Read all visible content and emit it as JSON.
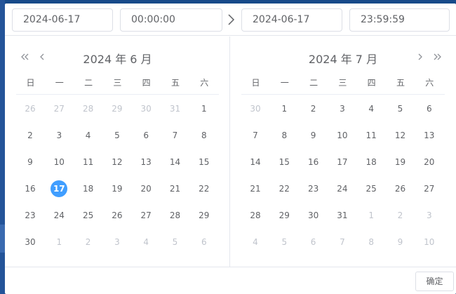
{
  "header": {
    "start_date": "2024-06-17",
    "start_time": "00:00:00",
    "end_date": "2024-06-17",
    "end_time": "23:59:59",
    "separator_icon": "chevron-right-icon"
  },
  "weekdays": [
    "日",
    "一",
    "二",
    "三",
    "四",
    "五",
    "六"
  ],
  "left_panel": {
    "title": "2024 年 6 月",
    "nav": [
      "double-chevron-left-icon",
      "chevron-left-icon"
    ],
    "weeks": [
      [
        {
          "d": "26",
          "m": true
        },
        {
          "d": "27",
          "m": true
        },
        {
          "d": "28",
          "m": true
        },
        {
          "d": "29",
          "m": true
        },
        {
          "d": "30",
          "m": true
        },
        {
          "d": "31",
          "m": true
        },
        {
          "d": "1"
        }
      ],
      [
        {
          "d": "2"
        },
        {
          "d": "3"
        },
        {
          "d": "4"
        },
        {
          "d": "5"
        },
        {
          "d": "6"
        },
        {
          "d": "7"
        },
        {
          "d": "8"
        }
      ],
      [
        {
          "d": "9"
        },
        {
          "d": "10"
        },
        {
          "d": "11"
        },
        {
          "d": "12"
        },
        {
          "d": "13"
        },
        {
          "d": "14"
        },
        {
          "d": "15"
        }
      ],
      [
        {
          "d": "16"
        },
        {
          "d": "17",
          "sel": true
        },
        {
          "d": "18"
        },
        {
          "d": "19"
        },
        {
          "d": "20"
        },
        {
          "d": "21"
        },
        {
          "d": "22"
        }
      ],
      [
        {
          "d": "23"
        },
        {
          "d": "24"
        },
        {
          "d": "25"
        },
        {
          "d": "26"
        },
        {
          "d": "27"
        },
        {
          "d": "28"
        },
        {
          "d": "29"
        }
      ],
      [
        {
          "d": "30"
        },
        {
          "d": "1",
          "m": true
        },
        {
          "d": "2",
          "m": true
        },
        {
          "d": "3",
          "m": true
        },
        {
          "d": "4",
          "m": true
        },
        {
          "d": "5",
          "m": true
        },
        {
          "d": "6",
          "m": true
        }
      ]
    ]
  },
  "right_panel": {
    "title": "2024 年 7 月",
    "nav": [
      "chevron-right-icon",
      "double-chevron-right-icon"
    ],
    "weeks": [
      [
        {
          "d": "30",
          "m": true
        },
        {
          "d": "1"
        },
        {
          "d": "2"
        },
        {
          "d": "3"
        },
        {
          "d": "4"
        },
        {
          "d": "5"
        },
        {
          "d": "6"
        }
      ],
      [
        {
          "d": "7"
        },
        {
          "d": "8"
        },
        {
          "d": "9"
        },
        {
          "d": "10"
        },
        {
          "d": "11"
        },
        {
          "d": "12"
        },
        {
          "d": "13"
        }
      ],
      [
        {
          "d": "14"
        },
        {
          "d": "15"
        },
        {
          "d": "16"
        },
        {
          "d": "17"
        },
        {
          "d": "18"
        },
        {
          "d": "19"
        },
        {
          "d": "20"
        }
      ],
      [
        {
          "d": "21"
        },
        {
          "d": "22"
        },
        {
          "d": "23"
        },
        {
          "d": "24"
        },
        {
          "d": "25"
        },
        {
          "d": "26"
        },
        {
          "d": "27"
        }
      ],
      [
        {
          "d": "28"
        },
        {
          "d": "29"
        },
        {
          "d": "30"
        },
        {
          "d": "31"
        },
        {
          "d": "1",
          "m": true
        },
        {
          "d": "2",
          "m": true
        },
        {
          "d": "3",
          "m": true
        }
      ],
      [
        {
          "d": "4",
          "m": true
        },
        {
          "d": "5",
          "m": true
        },
        {
          "d": "6",
          "m": true
        },
        {
          "d": "7",
          "m": true
        },
        {
          "d": "8",
          "m": true
        },
        {
          "d": "9",
          "m": true
        },
        {
          "d": "10",
          "m": true
        }
      ]
    ]
  },
  "footer": {
    "confirm_label": "确定"
  },
  "colors": {
    "accent": "#409eff",
    "muted": "#c0c4cc",
    "text": "#606266",
    "border": "#dcdfe6"
  }
}
